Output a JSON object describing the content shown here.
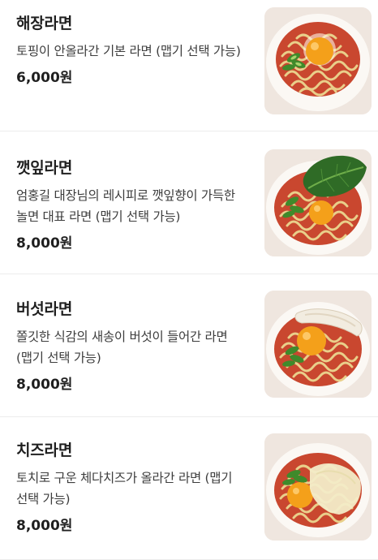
{
  "menu": {
    "items": [
      {
        "name": "해장라면",
        "description": "토핑이 안올라간 기본 라면 (맵기 선택 가능)",
        "price": "6,000원",
        "image_icon": "ramen-egg-scallion-photo"
      },
      {
        "name": "깻잎라면",
        "description": "엄홍길 대장님의 레시피로 깻잎향이 가득한 놀면 대표 라면 (맵기 선택 가능)",
        "price": "8,000원",
        "image_icon": "ramen-perilla-leaf-photo"
      },
      {
        "name": "버섯라면",
        "description": "쫄깃한 식감의 새송이 버섯이 들어간 라면 (맵기 선택 가능)",
        "price": "8,000원",
        "image_icon": "ramen-mushroom-photo"
      },
      {
        "name": "치즈라면",
        "description": "토치로 구운 체다치즈가 올라간 라면 (맵기 선택 가능)",
        "price": "8,000원",
        "image_icon": "ramen-cheese-photo"
      }
    ]
  },
  "colors": {
    "text_primary": "#1f1f1f",
    "text_secondary": "#3d3d3d",
    "divider": "#ececec",
    "broth": "#c9472f",
    "noodle": "#e9cf8a",
    "yolk": "#f4a01a",
    "scallion": "#3f8a2b",
    "perilla": "#2f6b26",
    "mushroom": "#f2ece0",
    "cheese": "#f3ecc8"
  }
}
